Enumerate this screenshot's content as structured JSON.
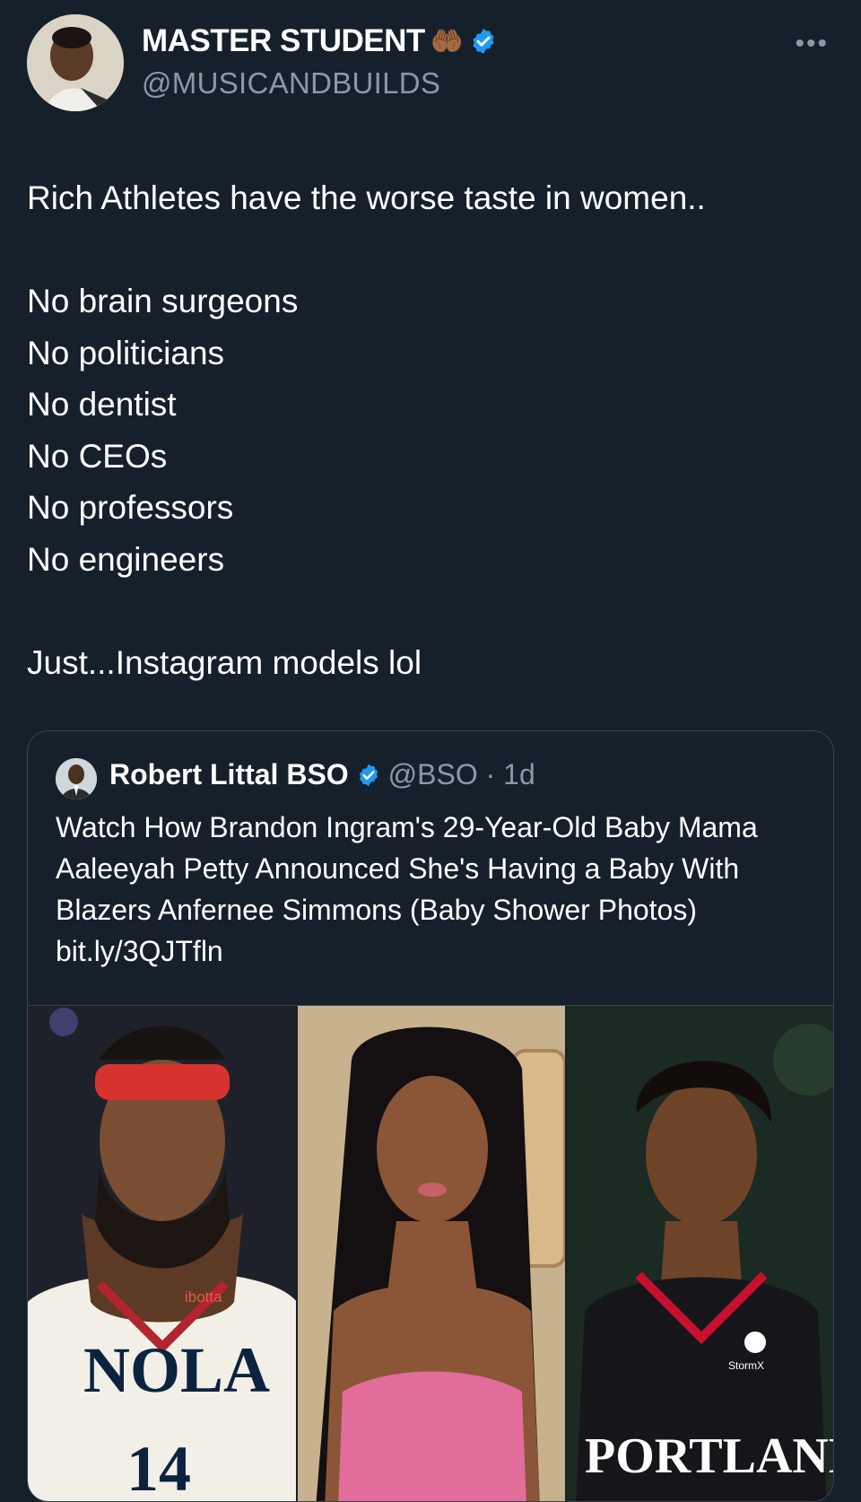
{
  "tweet": {
    "display_name": "MASTER STUDENT",
    "emoji": "🤲🏾",
    "handle": "@MUSICANDBUILDS",
    "more_label": "•••",
    "text_lines": [
      "Rich Athletes have the worse taste in women..",
      "",
      "No brain surgeons",
      "No politicians",
      "No dentist",
      "No CEOs",
      "No professors",
      "No engineers",
      "",
      "Just...Instagram models lol"
    ]
  },
  "quote": {
    "display_name": "Robert Littal BSO",
    "handle_time": "@BSO · 1d",
    "text": "Watch How Brandon Ingram's 29-Year-Old Baby Mama Aaleeyah Petty Announced She's Having a Baby With Blazers Anfernee Simmons (Baby Shower Photos) bit.ly/3QJTfln",
    "image_texts": {
      "jersey_left_sponsor": "ibotta",
      "jersey_left": "NOLA",
      "jersey_left_number": "14",
      "jersey_right_sponsor": "StormX",
      "jersey_right": "PORTLAND"
    }
  },
  "colors": {
    "background": "#15202b",
    "secondary_text": "#8b98a5",
    "verified": "#1d9bf0",
    "border": "#38444d"
  }
}
